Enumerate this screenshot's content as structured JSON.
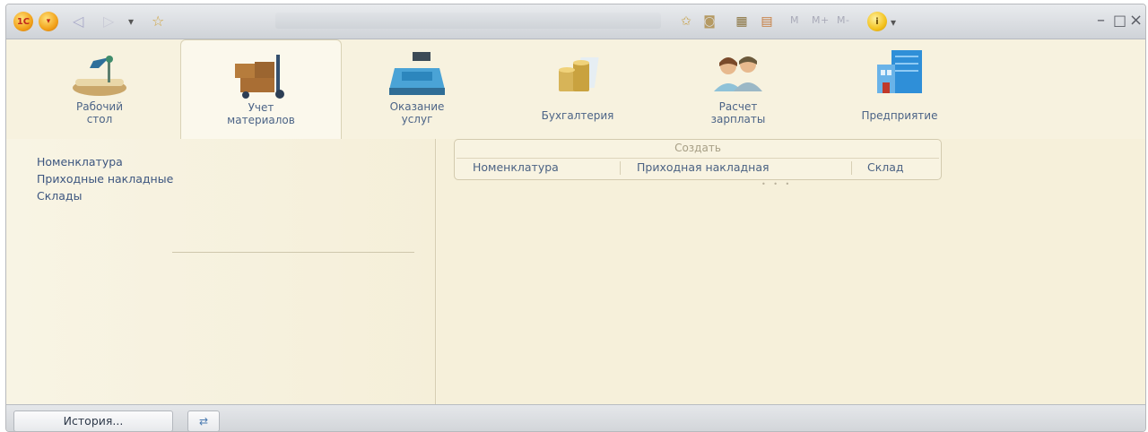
{
  "titlebar": {
    "logo": "1С",
    "menu_glyph": "▾",
    "back_glyph": "◁",
    "forward_glyph": "▷",
    "history_glyph": "▾",
    "favorites_glyph": "☆",
    "memory": [
      "M",
      "M+",
      "M-"
    ],
    "info_glyph": "i",
    "minimize": "–",
    "maximize": "□",
    "close": "×"
  },
  "sections": [
    {
      "label": "Рабочий\nстол",
      "icon": "desk-lamp-icon",
      "active": false
    },
    {
      "label": "Учет\nматериалов",
      "icon": "boxes-cart-icon",
      "active": true
    },
    {
      "label": "Оказание\nуслуг",
      "icon": "cash-register-icon",
      "active": false
    },
    {
      "label": "Бухгалтерия",
      "icon": "coins-icon",
      "active": false
    },
    {
      "label": "Расчет\nзарплаты",
      "icon": "people-icon",
      "active": false
    },
    {
      "label": "Предприятие",
      "icon": "building-icon",
      "active": false
    }
  ],
  "navigation": {
    "items": [
      "Номенклатура",
      "Приходные накладные",
      "Склады"
    ]
  },
  "actions": {
    "title": "Создать",
    "items": [
      "Номенклатура",
      "Приходная накладная",
      "Склад"
    ]
  },
  "statusbar": {
    "history_label": "История...",
    "connection_icon": "connection-icon"
  },
  "colors": {
    "background": "#f7f2df",
    "link": "#3c557f"
  }
}
